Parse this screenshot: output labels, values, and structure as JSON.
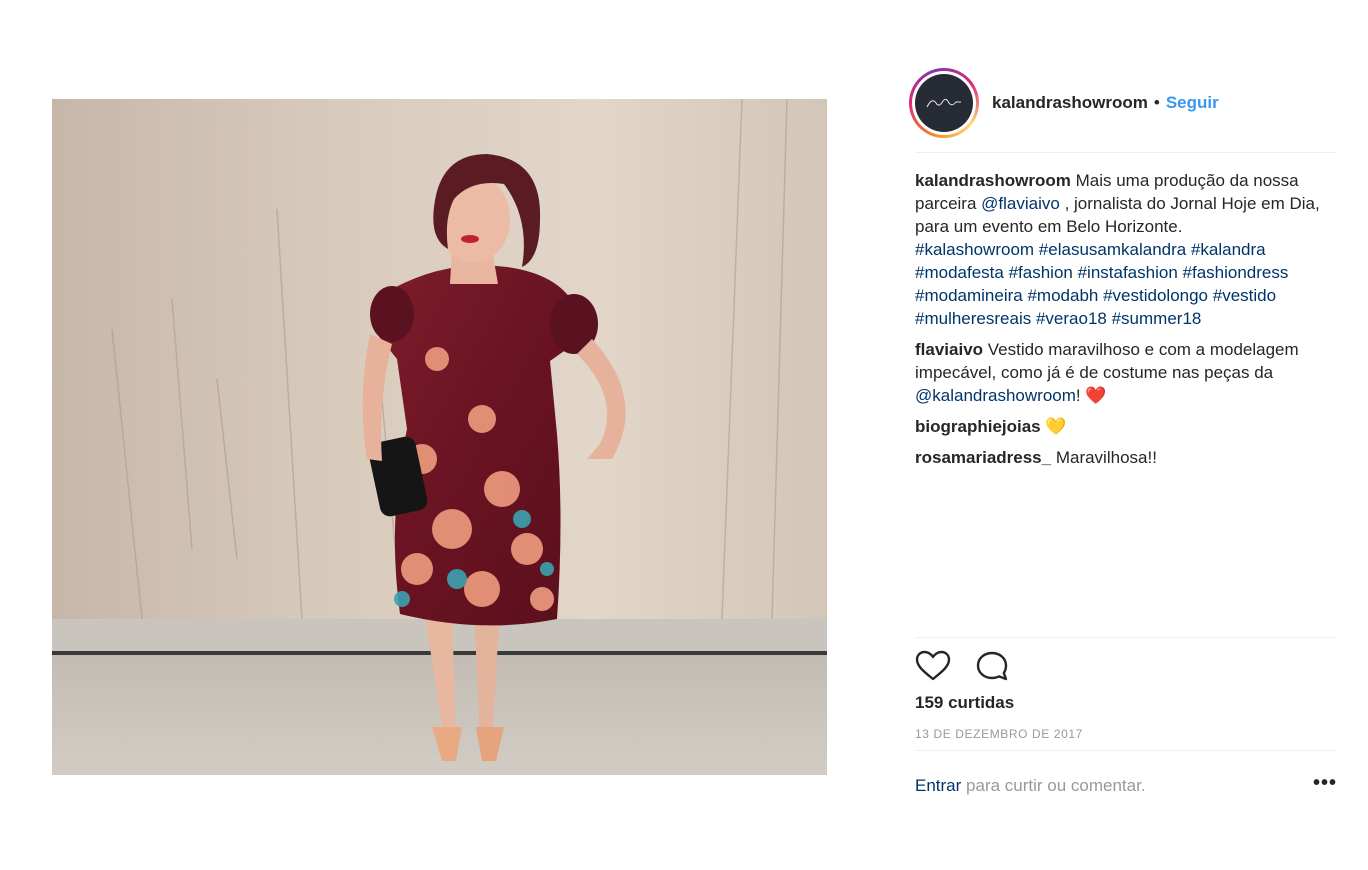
{
  "post": {
    "photo_label": "Woman in burgundy floral dress",
    "author": {
      "username": "kalandrashowroom",
      "separator": "•",
      "follow_label": "Seguir",
      "avatar_script": "Kalandra"
    },
    "caption": {
      "username": "kalandrashowroom",
      "text_1": "Mais uma produção da nossa parceira",
      "mention": "@flaviaivo",
      "text_2": ", jornalista do Jornal Hoje em Dia, para um evento em Belo Horizonte.",
      "hashtags": [
        "#kalashowroom",
        "#elasusamkalandra",
        "#kalandra",
        "#modafesta",
        "#fashion",
        "#instafashion",
        "#fashiondress",
        "#modamineira",
        "#modabh",
        "#vestidolongo",
        "#vestido",
        "#mulheresreais",
        "#verao18",
        "#summer18"
      ]
    },
    "comments": [
      {
        "username": "flaviaivo",
        "text": "Vestido maravilhoso e com a modelagem impecável, como já é de costume nas peças da",
        "mention": "@kalandrashowroom",
        "suffix": "!",
        "emoji": "❤️"
      },
      {
        "username": "biographiejoias",
        "text": "",
        "emoji": "💛"
      },
      {
        "username": "rosamariadress_",
        "text": "Maravilhosa!!"
      }
    ],
    "likes_text": "159 curtidas",
    "date": "13 DE DEZEMBRO DE 2017",
    "login_prompt": {
      "link": "Entrar",
      "text": "para curtir ou comentar."
    },
    "more_label": "•••",
    "icons": {
      "like": "heart-icon",
      "comment": "comment-icon"
    },
    "colors": {
      "link_blue": "#3897f0",
      "hashtag": "#003569",
      "muted": "#999999"
    }
  }
}
